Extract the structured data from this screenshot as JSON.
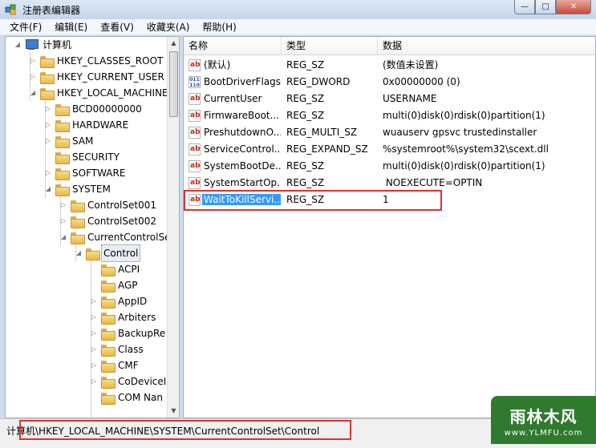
{
  "window": {
    "title": "注册表编辑器",
    "controls": [
      "—",
      "□",
      "✕"
    ]
  },
  "menu": [
    "文件(F)",
    "编辑(E)",
    "查看(V)",
    "收藏夹(A)",
    "帮助(H)"
  ],
  "tree": {
    "root": "计算机",
    "hives": [
      "HKEY_CLASSES_ROOT",
      "HKEY_CURRENT_USER",
      "HKEY_LOCAL_MACHINE"
    ],
    "hklm_children": [
      "BCD00000000",
      "HARDWARE",
      "SAM",
      "SECURITY",
      "SOFTWARE",
      "SYSTEM"
    ],
    "system_children": [
      "ControlSet001",
      "ControlSet002",
      "CurrentControlSet"
    ],
    "ccs_children": [
      "Control"
    ],
    "control_children": [
      "ACPI",
      "AGP",
      "AppID",
      "Arbiters",
      "BackupRe",
      "Class",
      "CMF",
      "CoDeviceI",
      "COM Nan"
    ]
  },
  "list": {
    "headers": [
      "名称",
      "类型",
      "数据"
    ],
    "rows": [
      {
        "icon": "ab",
        "name": "(默认)",
        "type": "REG_SZ",
        "data": "(数值未设置)"
      },
      {
        "icon": "bin",
        "name": "BootDriverFlags",
        "type": "REG_DWORD",
        "data": "0x00000000 (0)"
      },
      {
        "icon": "ab",
        "name": "CurrentUser",
        "type": "REG_SZ",
        "data": "USERNAME"
      },
      {
        "icon": "ab",
        "name": "FirmwareBoot...",
        "type": "REG_SZ",
        "data": "multi(0)disk(0)rdisk(0)partition(1)"
      },
      {
        "icon": "ab",
        "name": "PreshutdownO...",
        "type": "REG_MULTI_SZ",
        "data": "wuauserv gpsvc trustedinstaller"
      },
      {
        "icon": "ab",
        "name": "ServiceControl...",
        "type": "REG_EXPAND_SZ",
        "data": "%systemroot%\\system32\\scext.dll"
      },
      {
        "icon": "ab",
        "name": "SystemBootDe...",
        "type": "REG_SZ",
        "data": "multi(0)disk(0)rdisk(0)partition(1)"
      },
      {
        "icon": "ab",
        "name": "SystemStartOp...",
        "type": "REG_SZ",
        "data": " NOEXECUTE=OPTIN"
      },
      {
        "icon": "ab",
        "name": "WaitToKillServi...",
        "type": "REG_SZ",
        "data": "1"
      }
    ]
  },
  "status": {
    "path": "计算机\\HKEY_LOCAL_MACHINE\\SYSTEM\\CurrentControlSet\\Control"
  },
  "watermark": {
    "main": "雨林木风",
    "sub": "www.YLMFU.com"
  },
  "colors": {
    "highlight": "#e03030",
    "selection": "#3399ff"
  }
}
